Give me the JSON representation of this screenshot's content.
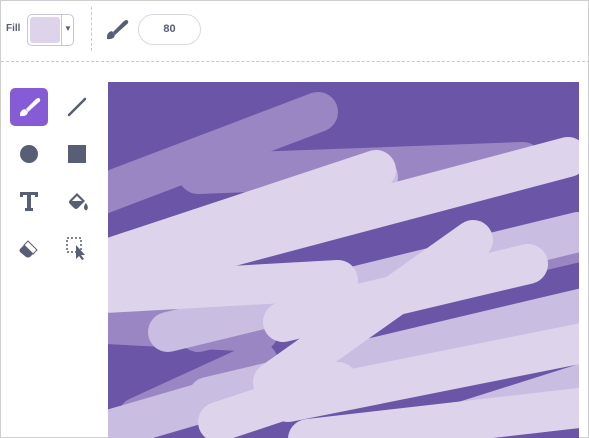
{
  "toolbar": {
    "fill_label": "Fill",
    "fill_color": "#ddd3ea",
    "brush_size": "80"
  },
  "tools": [
    {
      "name": "brush-tool",
      "icon": "brush-icon",
      "active": true
    },
    {
      "name": "line-tool",
      "icon": "line-icon",
      "active": false
    },
    {
      "name": "circle-tool",
      "icon": "circle-icon",
      "active": false
    },
    {
      "name": "rectangle-tool",
      "icon": "rectangle-icon",
      "active": false
    },
    {
      "name": "text-tool",
      "icon": "text-icon",
      "active": false
    },
    {
      "name": "fill-tool",
      "icon": "paint-bucket-icon",
      "active": false
    },
    {
      "name": "eraser-tool",
      "icon": "eraser-icon",
      "active": false
    },
    {
      "name": "select-tool",
      "icon": "select-icon",
      "active": false
    }
  ],
  "colors": {
    "accent": "#855cd6",
    "canvas_background": "#6a55a6",
    "stroke_dark": "#9b86c4",
    "stroke_mid": "#c9bde1",
    "stroke_light": "#ddd3ea",
    "icon": "#575e75"
  }
}
